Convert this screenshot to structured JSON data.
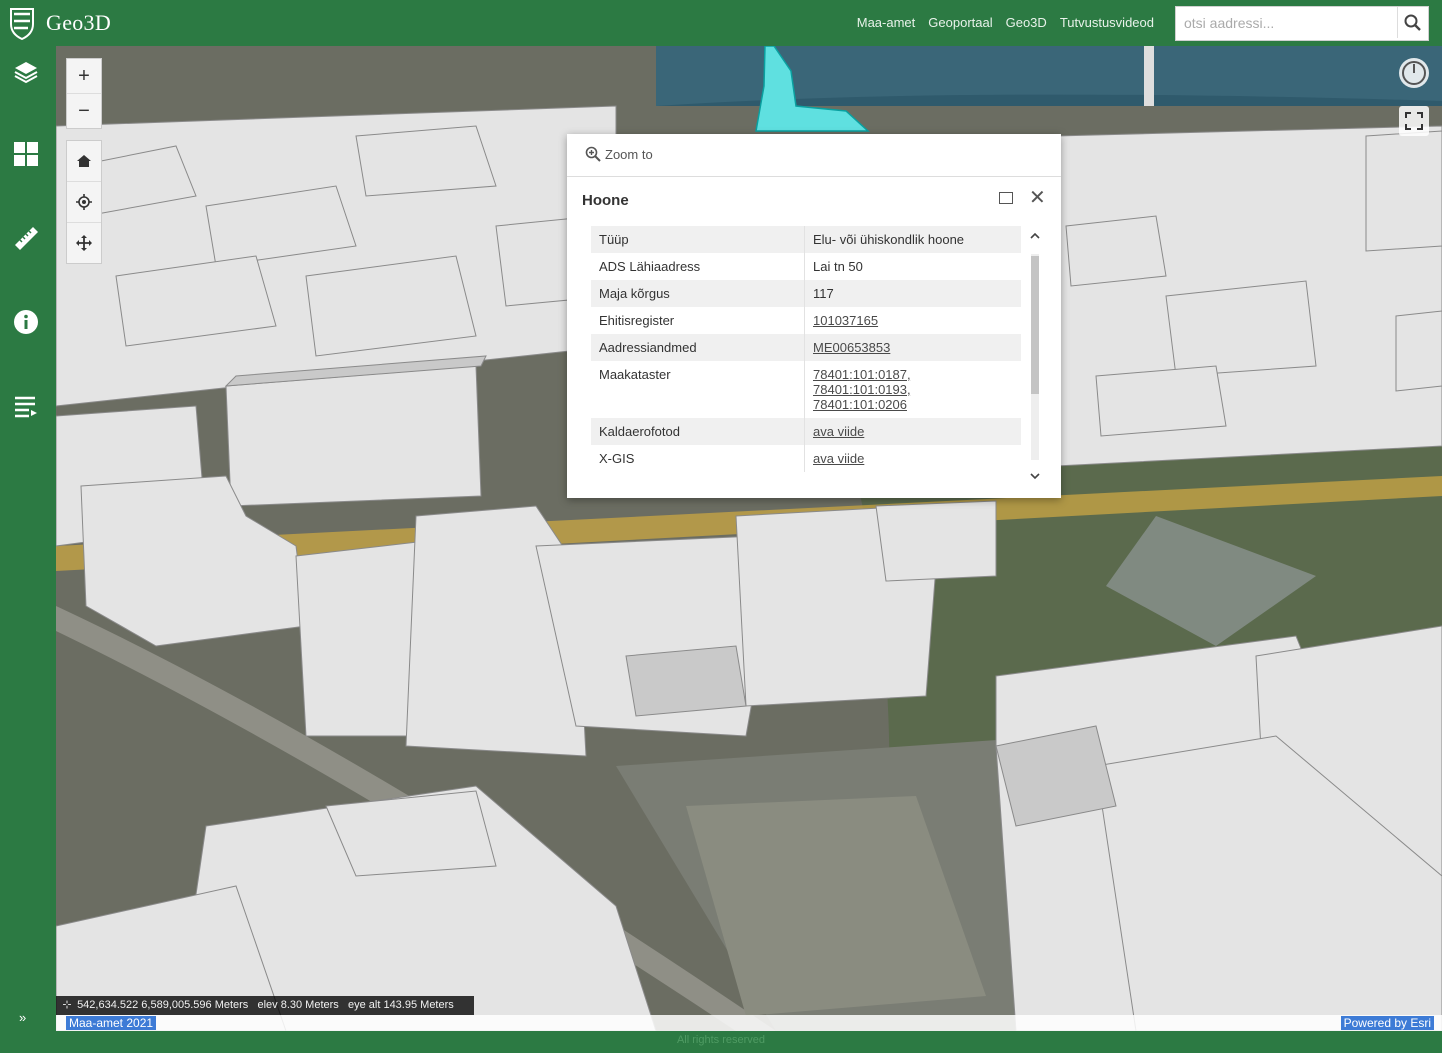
{
  "app": {
    "title": "Geo3D"
  },
  "nav": {
    "links": [
      "Maa-amet",
      "Geoportaal",
      "Geo3D",
      "Tutvustusvideod"
    ]
  },
  "search": {
    "placeholder": "otsi aadressi..."
  },
  "sidebar": {
    "items": [
      "layers-icon",
      "basemap-grid-icon",
      "measure-ruler-icon",
      "info-icon",
      "legend-list-icon"
    ]
  },
  "map": {
    "zoom_in": "+",
    "zoom_out": "−"
  },
  "popup": {
    "zoom_to": "Zoom to",
    "title": "Hoone",
    "rows": [
      {
        "key": "Tüüp",
        "value": "Elu- või ühiskondlik hoone"
      },
      {
        "key": "ADS Lähiaadress",
        "value": "Lai tn 50"
      },
      {
        "key": "Maja kõrgus",
        "value": "117"
      },
      {
        "key": "Ehitisregister",
        "value": "101037165"
      },
      {
        "key": "Aadressiandmed",
        "value": "ME00653853"
      },
      {
        "key": "Maakataster",
        "values": [
          "78401:101:0187,",
          "78401:101:0193,",
          "78401:101:0206"
        ]
      },
      {
        "key": "Kaldaerofotod",
        "value": "ava viide"
      },
      {
        "key": "X-GIS",
        "value": "ava viide"
      }
    ]
  },
  "status": {
    "coordinates": "542,634.522 6,589,005.596 Meters",
    "elev": "elev 8.30 Meters",
    "eye_alt": "eye alt 143.95 Meters"
  },
  "attribution": {
    "left": "Maa-amet 2021",
    "right": "Powered by Esri"
  },
  "footer": {
    "text": "All rights reserved"
  }
}
